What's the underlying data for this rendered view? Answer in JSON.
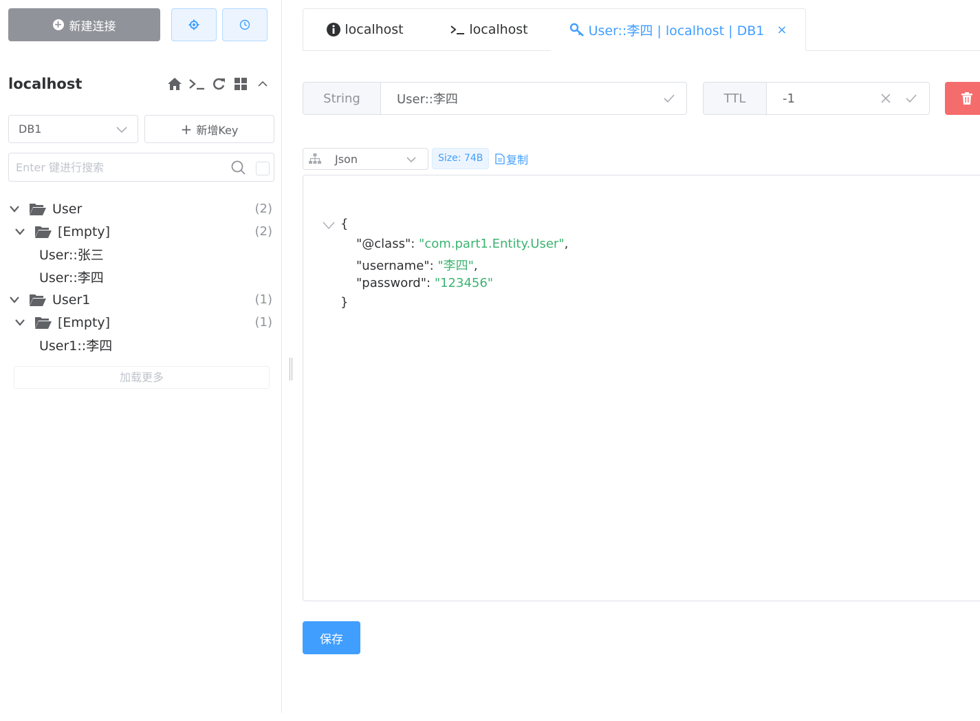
{
  "sidebar": {
    "new_connection_label": "新建连接",
    "connection_name": "localhost",
    "db_select_value": "DB1",
    "add_key_label": "新增Key",
    "search_placeholder": "Enter 键进行搜索",
    "tree": [
      {
        "label": "User",
        "count": "(2)",
        "type": "folder"
      },
      {
        "label": "[Empty]",
        "count": "(2)",
        "type": "folder"
      },
      {
        "label": "User::张三",
        "type": "key"
      },
      {
        "label": "User::李四",
        "type": "key"
      },
      {
        "label": "User1",
        "count": "(1)",
        "type": "folder"
      },
      {
        "label": "[Empty]",
        "count": "(1)",
        "type": "folder"
      },
      {
        "label": "User1::李四",
        "type": "key"
      }
    ],
    "load_more_label": "加载更多"
  },
  "tabs": [
    {
      "label": "localhost",
      "icon": "info-icon"
    },
    {
      "label": "localhost",
      "icon": "terminal-icon"
    },
    {
      "label": "User::李四 | localhost | DB1",
      "icon": "key-icon",
      "active": true,
      "closable": true
    }
  ],
  "key_detail": {
    "type_label": "String",
    "key_name": "User::李四",
    "ttl_label": "TTL",
    "ttl_value": "-1"
  },
  "viewer": {
    "format_value": "Json",
    "size_label": "Size: 74B",
    "copy_label": "复制",
    "json": {
      "open": "{",
      "lines": [
        {
          "key": "\"@class\"",
          "value": "\"com.part1.Entity.User\"",
          "comma": ","
        },
        {
          "key": "\"username\"",
          "value": "\"李四\"",
          "comma": ","
        },
        {
          "key": "\"password\"",
          "value": "\"123456\"",
          "comma": ""
        }
      ],
      "close": "}"
    }
  },
  "save_label": "保存",
  "colors": {
    "primary": "#409eff",
    "danger": "#f56c6c",
    "gray_button": "#909399",
    "json_string": "#3cb371"
  }
}
